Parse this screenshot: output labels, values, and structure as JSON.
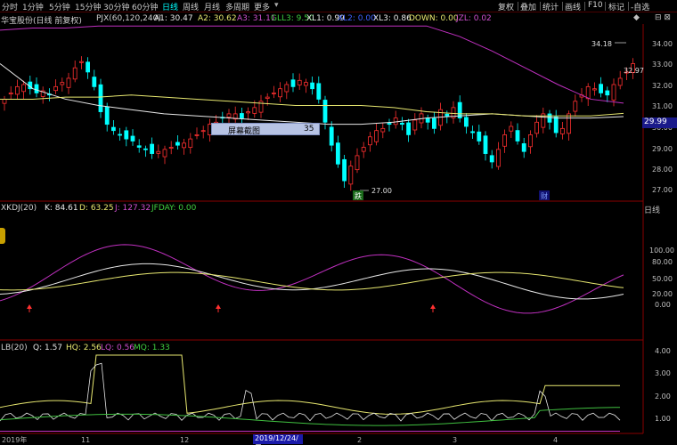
{
  "toolbar": {
    "periods": [
      "分时",
      "1分钟",
      "5分钟",
      "15分钟",
      "30分钟",
      "60分钟",
      "日线",
      "周线",
      "月线",
      "多周期",
      "更多"
    ],
    "active_period": "日线",
    "right_buttons": [
      "复权",
      "叠加",
      "统计",
      "画线",
      "F10",
      "标记",
      "-自选"
    ]
  },
  "main_header": {
    "stock": "华宝股份(日线 前复权)",
    "indicator": "PJX(60,120,240)",
    "a1": "A1: 30.47",
    "a2": "A2: 30.62",
    "a3": "A3: 31.11",
    "gll3": "GLL3: 9.50",
    "xl1": "XL1: 0.99",
    "xl2": "XL2: 0.00",
    "xl3": "XL3: 0.86",
    "down": "DOWN: 0.00",
    "jzl": "JZL: 0.02"
  },
  "main_axis": [
    "34.00",
    "33.00",
    "32.00",
    "31.00",
    "30.00",
    "29.00",
    "28.00",
    "27.00"
  ],
  "price_high_label": "34.18",
  "price_last_label": "32.97",
  "price_tag": "29.99",
  "price_low_label": "27.00",
  "marker_die": "跌",
  "marker_cai": "财",
  "popup": {
    "label": "屏幕截图",
    "value": "35"
  },
  "kdj_header": {
    "name": "XKDJ(20)",
    "k": "K: 84.61",
    "d": "D: 63.25",
    "j": "J: 127.32",
    "jfday": "JFDAY: 0.00"
  },
  "kdj_axis": [
    "100.00",
    "80.00",
    "50.00",
    "20.00",
    "0.00"
  ],
  "right_tab": "日线",
  "lb_header": {
    "name": "LB(20)",
    "q": "Q: 1.57",
    "hq": "HQ: 2.56",
    "lq": "LQ: 0.56",
    "mq": "MQ: 1.33"
  },
  "lb_axis": [
    "4.00",
    "3.00",
    "2.00",
    "1.00"
  ],
  "date_axis": [
    "2019年",
    "11",
    "12",
    "2",
    "3",
    "4"
  ],
  "date_marker": "2019/12/24/二",
  "colors": {
    "up": "#ff3030",
    "down": "#00ffff",
    "ma_white": "#e8e8e8",
    "ma_yellow": "#e8e870",
    "ma_purple": "#c030c0",
    "lb_green": "#40c040"
  },
  "chart_data": [
    {
      "type": "line",
      "title": "PJX(60,120,240)",
      "ylim": [
        26.5,
        34.8
      ],
      "series": [
        {
          "name": "A1",
          "values": [
            33.0,
            31.8,
            31.3,
            31.0,
            30.8,
            30.6,
            30.5,
            30.4,
            30.3,
            30.2,
            30.1,
            30.1,
            30.2,
            30.4,
            30.5,
            30.6,
            30.5,
            30.4,
            30.4,
            30.47
          ]
        },
        {
          "name": "A2",
          "values": [
            31.3,
            31.3,
            31.4,
            31.4,
            31.5,
            31.4,
            31.3,
            31.2,
            31.1,
            31.0,
            31.0,
            31.0,
            30.9,
            30.7,
            30.6,
            30.6,
            30.5,
            30.5,
            30.5,
            30.62
          ]
        },
        {
          "name": "A3",
          "values": [
            34.6,
            34.7,
            34.7,
            34.8,
            34.8,
            34.8,
            34.8,
            34.8,
            34.8,
            34.8,
            34.8,
            34.8,
            34.8,
            34.8,
            34.3,
            33.6,
            32.8,
            32.0,
            31.3,
            31.11
          ]
        }
      ]
    }
  ]
}
